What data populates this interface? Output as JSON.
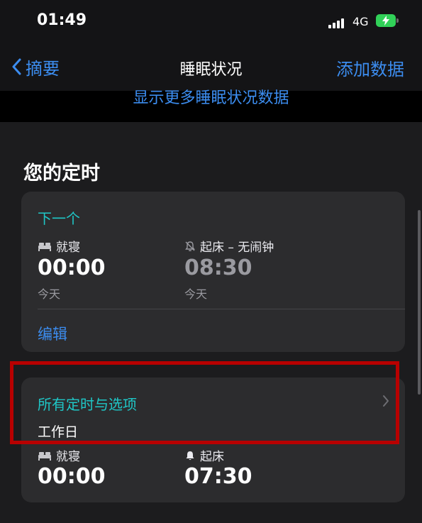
{
  "status_bar": {
    "time": "01:49",
    "network": "4G"
  },
  "nav": {
    "back_label": "摘要",
    "title": "睡眠状况",
    "action_label": "添加数据"
  },
  "show_more_link": "显示更多睡眠状况数据",
  "schedule": {
    "section_title": "您的定时",
    "next": {
      "header": "下一个",
      "bedtime_label": "就寝",
      "bedtime_value": "00:00",
      "bedtime_day": "今天",
      "wake_label": "起床 – 无闹钟",
      "wake_value": "08:30",
      "wake_day": "今天",
      "edit_label": "编辑"
    },
    "all": {
      "header": "所有定时与选项",
      "schedule_name": "工作日",
      "bedtime_label": "就寝",
      "bedtime_value": "00:00",
      "wake_label": "起床",
      "wake_value": "07:30"
    }
  },
  "colors": {
    "accent_blue": "#3c8df0",
    "accent_teal": "#1fc7c7",
    "highlight_red": "#b80000",
    "battery_green": "#31d158"
  }
}
